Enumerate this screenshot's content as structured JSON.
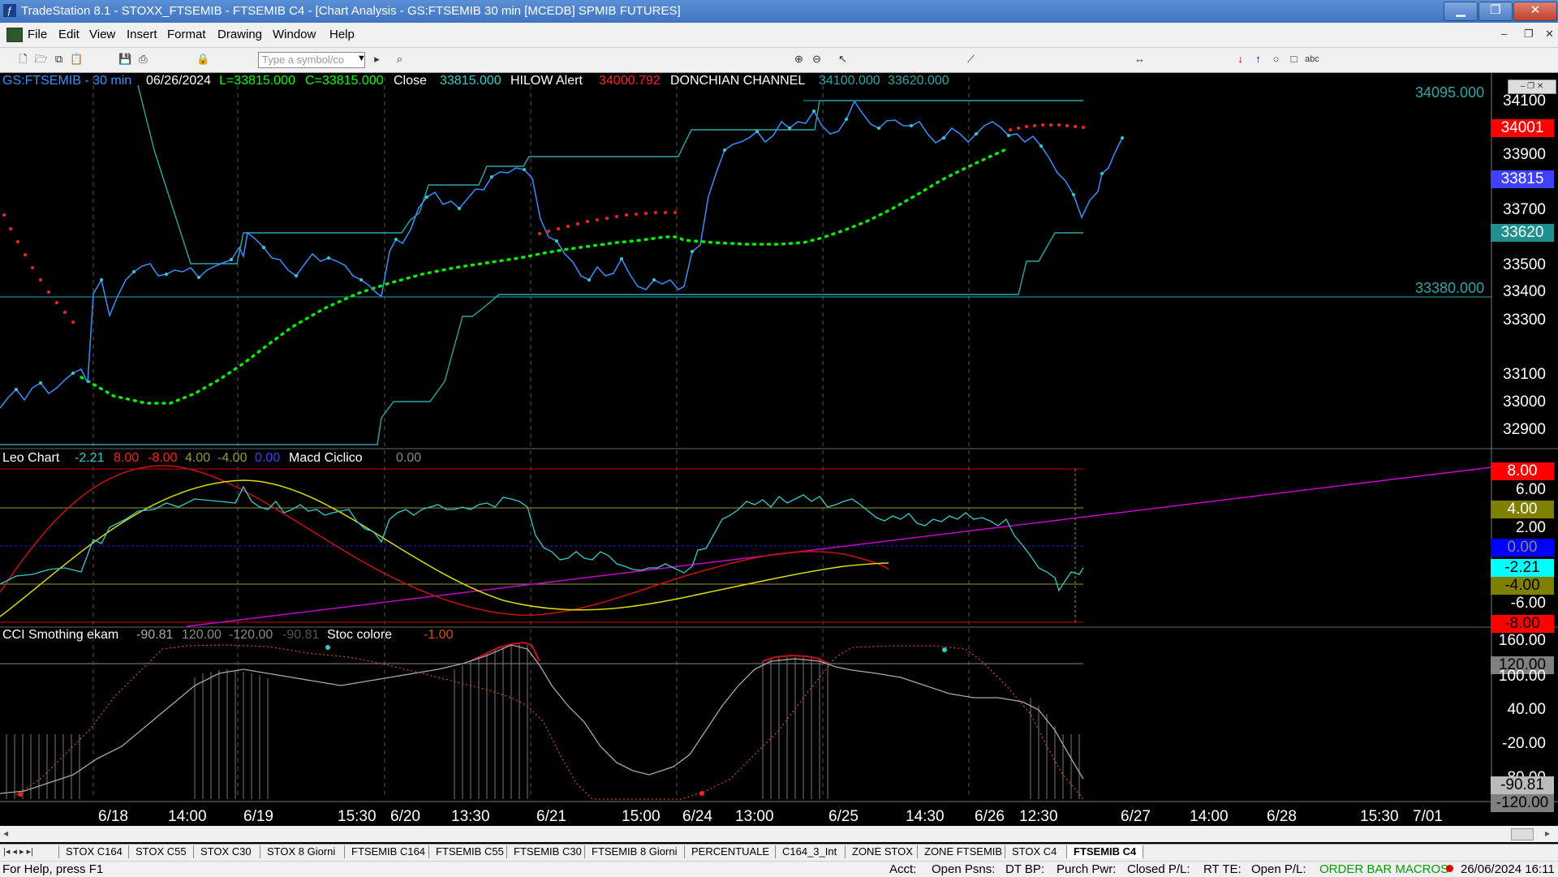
{
  "window": {
    "title": "TradeStation 8.1 - STOXX_FTSEMIB - FTSEMIB C4 - [Chart Analysis - GS:FTSEMIB  30 min  [MCEDB] SPMIB FUTURES]"
  },
  "menu": [
    "File",
    "Edit",
    "View",
    "Insert",
    "Format",
    "Drawing",
    "Window",
    "Help"
  ],
  "toolbar": {
    "symbol_placeholder": "Type a symbol/co"
  },
  "price_panel": {
    "symbol": "GS:FTSEMIB - 30 min",
    "date": "06/26/2024",
    "low": "L=33815.000",
    "close_eq": "C=33815.000",
    "close_label": "Close",
    "close_val": "33815.000",
    "hilow_label": "HILOW Alert",
    "hilow_val": "34000.792",
    "donchian_label": "DONCHIAN CHANNEL",
    "donchian_hi": "34100.000",
    "donchian_lo": "33620.000",
    "level_top": "34095.000",
    "level_bottom": "33380.000",
    "axis": [
      "34100",
      "33900",
      "33700",
      "33500",
      "33400",
      "33300",
      "33100",
      "33000",
      "32900"
    ],
    "boxes": {
      "hilow": "34001",
      "close": "33815",
      "donchian_lo": "33620"
    }
  },
  "leo_panel": {
    "name": "Leo Chart",
    "vals": [
      "-2.21",
      "8.00",
      "-8.00",
      "4.00",
      "-4.00",
      "0.00"
    ],
    "macd_label": "Macd Ciclico",
    "macd_val": "0.00",
    "axis": [
      "6.00",
      "2.00",
      "-6.00"
    ],
    "boxes": [
      "8.00",
      "4.00",
      "0.00",
      "-2.21",
      "-4.00",
      "-8.00"
    ]
  },
  "cci_panel": {
    "name": "CCI Smothing ekam",
    "vals": [
      "-90.81",
      "120.00",
      "-120.00",
      "-90.81"
    ],
    "stoc_label": "Stoc colore",
    "stoc_val": "-1.00",
    "axis": [
      "160.00",
      "100.00",
      "40.00",
      "-20.00",
      "-80.00"
    ],
    "boxes": [
      "120.00",
      "-90.81",
      "-120.00"
    ]
  },
  "dates": [
    "6/18",
    "14:00",
    "6/19",
    "15:30",
    "6/20",
    "13:30",
    "6/21",
    "15:00",
    "6/24",
    "13:00",
    "6/25",
    "14:30",
    "6/26",
    "12:30",
    "6/27",
    "14:00",
    "6/28",
    "15:30",
    "7/01"
  ],
  "tabs": [
    "STOX C164",
    "STOX C55",
    "STOX  C30",
    "STOX  8 Giorni",
    "FTSEMIB C164",
    "FTSEMIB C55",
    "FTSEMIB C30",
    "FTSEMIB  8 Giorni",
    "PERCENTUALE",
    "C164_3_Int",
    "ZONE STOX",
    "ZONE FTSEMIB",
    "STOX  C4",
    "FTSEMIB C4"
  ],
  "status": {
    "help": "For Help, press F1",
    "acct": "Acct:",
    "open_psns": "Open Psns:",
    "dt_bp": "DT BP:",
    "purch": "Purch Pwr:",
    "closed_pl": "Closed P/L:",
    "rt_te": "RT TE:",
    "open_pl": "Open P/L:",
    "macros": "ORDER BAR  MACROS",
    "datetime": "26/06/2024 16:11"
  },
  "colors": {
    "cyan": "#33cccc",
    "green": "#00ff00",
    "red": "#ff0000",
    "yellow": "#ffff00",
    "magenta": "#cc00cc",
    "teal": "#2aa7a7"
  }
}
